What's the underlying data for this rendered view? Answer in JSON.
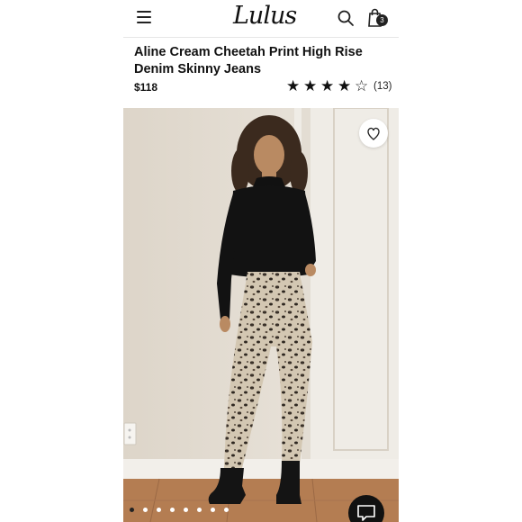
{
  "header": {
    "logo_text": "Lulus",
    "bag_count": "3",
    "icons": [
      "hamburger-menu-icon",
      "search-icon",
      "shopping-bag-icon"
    ]
  },
  "product": {
    "title": "Aline Cream Cheetah Print High Rise Denim Skinny Jeans",
    "price": "$118",
    "rating": 4,
    "rating_max": 5,
    "review_count": "(13)"
  },
  "gallery": {
    "image_count": 8,
    "active_index": 0
  },
  "colors": {
    "text": "#111111",
    "accent_dark": "#222222",
    "photo_wall": "#e8e2d8",
    "floor": "#b47d52"
  }
}
